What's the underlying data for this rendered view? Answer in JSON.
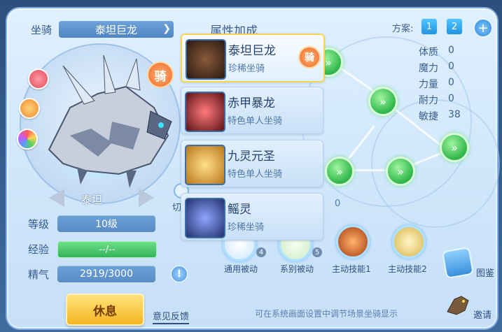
{
  "mount_label": "坐骑",
  "mount_name": "泰坦巨龙",
  "ride_badge": "骑",
  "stage_name": "泰坦",
  "level": {
    "label": "等级",
    "value": "10级"
  },
  "exp": {
    "label": "经验",
    "value": "--/--"
  },
  "spirit": {
    "label": "精气",
    "value": "2919/3000"
  },
  "attr_header": "属性加成",
  "plan_label": "方案:",
  "plans": [
    "1",
    "2"
  ],
  "stats": [
    {
      "name": "体质",
      "value": "0"
    },
    {
      "name": "魔力",
      "value": "0"
    },
    {
      "name": "力量",
      "value": "0"
    },
    {
      "name": "耐力",
      "value": "0"
    },
    {
      "name": "敏捷",
      "value": "38"
    }
  ],
  "mount_list": [
    {
      "name": "泰坦巨龙",
      "type": "珍稀坐骑",
      "color": "#3a2a20",
      "badge": "骑"
    },
    {
      "name": "赤甲暴龙",
      "type": "特色单人坐骑",
      "color": "#8a2a30"
    },
    {
      "name": "九灵元圣",
      "type": "特色单人坐骑",
      "color": "#c9962b"
    },
    {
      "name": "鳐灵",
      "type": "珍稀坐骑",
      "color": "#3b4f9a"
    }
  ],
  "partial_texts": {
    "switch": "切",
    "zero": "0"
  },
  "skills": [
    {
      "label": "通用被动",
      "count": "4"
    },
    {
      "label": "系别被动",
      "count": "5"
    },
    {
      "label": "主动技能1",
      "count": ""
    },
    {
      "label": "主动技能2",
      "count": ""
    }
  ],
  "rest_button": "休息",
  "feedback_tab": "意见反馈",
  "hint_text": "可在系统画面设置中调节场景坐骑显示",
  "codex_label": "图鉴",
  "invite_label": "邀请",
  "info_icon": "!",
  "node_glyph": "»"
}
